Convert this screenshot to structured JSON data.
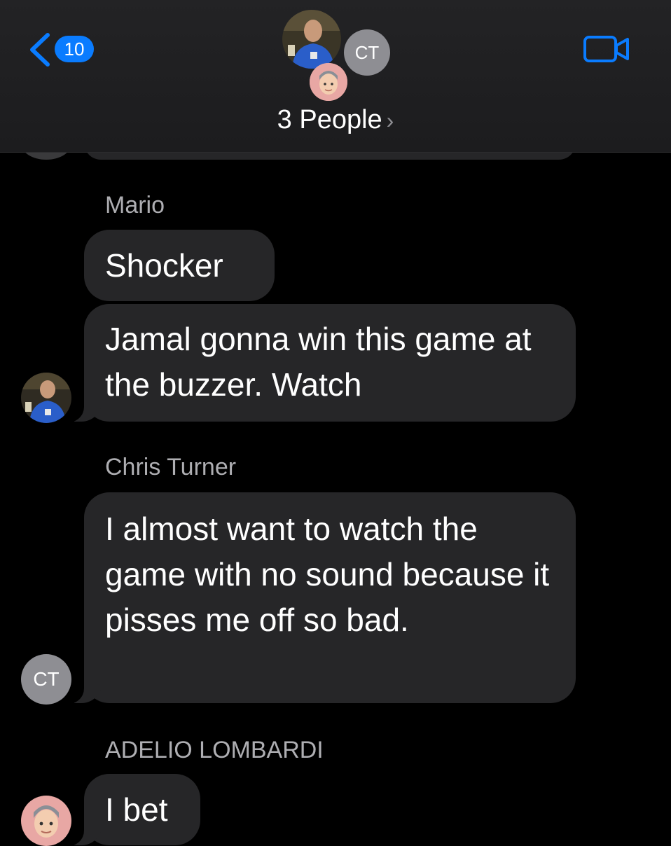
{
  "header": {
    "back_count": "10",
    "avatar_ct_initials": "CT",
    "group_title": "3 People",
    "chevron": "›"
  },
  "icons": {
    "back": "chevron-left-icon",
    "video": "video-camera-icon"
  },
  "colors": {
    "accent": "#0a7cff",
    "bubble": "#262628",
    "sender_text": "#aeaeb2"
  },
  "messages": [
    {
      "sender": "Mario",
      "bubbles": [
        "Shocker",
        "Jamal gonna win this game at the buzzer. Watch"
      ]
    },
    {
      "sender": "Chris Turner",
      "initials": "CT",
      "bubbles": [
        "I almost want to watch the game with no sound because it pisses me off so bad."
      ]
    },
    {
      "sender": "ADELIO LOMBARDI",
      "bubbles": [
        "I bet"
      ]
    }
  ]
}
